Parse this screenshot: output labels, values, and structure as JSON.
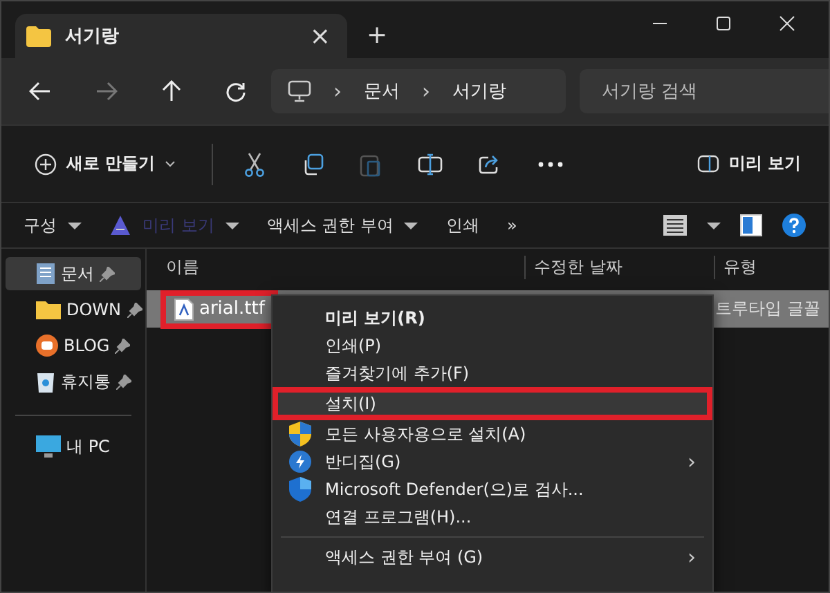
{
  "tab": {
    "title": "서기랑",
    "close": "×"
  },
  "new_tab": "+",
  "address": {
    "crumbs": [
      "문서",
      "서기랑"
    ],
    "separator": "›"
  },
  "search": {
    "placeholder": "서기랑 검색"
  },
  "command_bar": {
    "new_label": "새로 만들기",
    "preview_label": "미리 보기"
  },
  "classic_toolbar": [
    {
      "kind": "menu",
      "label": "구성"
    },
    {
      "kind": "iconmenu",
      "label": "미리 보기",
      "disabled": true
    },
    {
      "kind": "menu",
      "label": "액세스 권한 부여"
    },
    {
      "kind": "plain",
      "label": "인쇄"
    },
    {
      "kind": "plain",
      "label": "»"
    }
  ],
  "sidebar": {
    "items": [
      {
        "label": "문서",
        "kind": "doc",
        "pinned": true,
        "selected": true
      },
      {
        "label": "DOWN",
        "kind": "folder",
        "pinned": true,
        "selected": false
      },
      {
        "label": "BLOG",
        "kind": "blog",
        "pinned": true,
        "selected": false
      },
      {
        "label": "휴지통",
        "kind": "bin",
        "pinned": true,
        "selected": false
      }
    ],
    "this_pc": "내 PC"
  },
  "columns": [
    "이름",
    "수정한 날짜",
    "유형"
  ],
  "file": {
    "name": "arial.ttf",
    "type": "트루타입 글꼴",
    "selected": true,
    "highlighted": true
  },
  "context_menu": [
    {
      "kind": "text",
      "label": "미리 보기(R)",
      "bold": true,
      "highlighted": false
    },
    {
      "kind": "text",
      "label": "인쇄(P)",
      "bold": false,
      "highlighted": false
    },
    {
      "kind": "text",
      "label": "즐겨찾기에 추가(F)",
      "bold": false,
      "highlighted": false
    },
    {
      "kind": "text",
      "label": "설치(I)",
      "bold": false,
      "highlighted": true
    },
    {
      "kind": "shield",
      "label": "모든 사용자용으로 설치(A)",
      "bold": false,
      "highlighted": false
    },
    {
      "kind": "bolt",
      "label": "반디집(G)",
      "bold": false,
      "highlighted": false,
      "submenu_arrow": "›"
    },
    {
      "kind": "defender",
      "label": "Microsoft Defender(으)로 검사...",
      "bold": false,
      "highlighted": false
    },
    {
      "kind": "text",
      "label": "연결 프로그램(H)...",
      "bold": false,
      "highlighted": false
    },
    {
      "kind": "separator"
    },
    {
      "kind": "text",
      "label": "액세스 권한 부여 (G)",
      "bold": false,
      "highlighted": false,
      "submenu_arrow": "›"
    }
  ]
}
